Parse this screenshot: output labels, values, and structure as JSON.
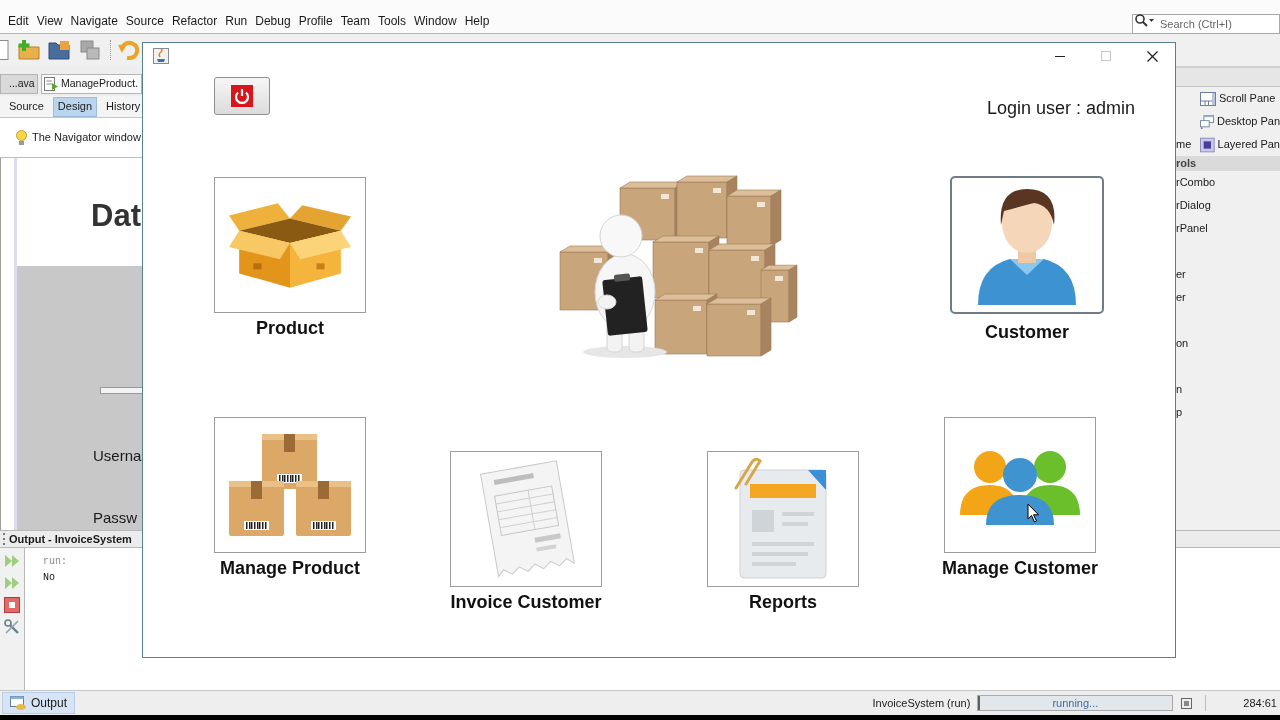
{
  "ide": {
    "menu": [
      "Edit",
      "View",
      "Navigate",
      "Source",
      "Refactor",
      "Run",
      "Debug",
      "Profile",
      "Team",
      "Tools",
      "Window",
      "Help"
    ],
    "search": {
      "placeholder": "Search (Ctrl+I)"
    },
    "editor_tabs": [
      {
        "label": "...ava",
        "selected": false
      },
      {
        "label": "ManageProduct.",
        "selected": true
      }
    ],
    "view_tabs": [
      {
        "label": "Source",
        "selected": false
      },
      {
        "label": "Design",
        "selected": true
      },
      {
        "label": "History",
        "selected": false
      }
    ],
    "navigator_hint": "The Navigator window",
    "design_form": {
      "heading": "Dat",
      "labels": [
        "Userna",
        "Passw"
      ]
    },
    "palette": {
      "rows": [
        {
          "right": "Scroll Pane",
          "kind": "scroll"
        },
        {
          "right": "Desktop Pan",
          "kind": "desktop"
        },
        {
          "left": "me",
          "right": "Layered Pan",
          "kind": "layered"
        }
      ],
      "section": "rols",
      "groups": [
        [
          "rCombo",
          "rDialog",
          "rPanel"
        ],
        [
          "er",
          "er"
        ],
        [
          "on"
        ],
        [
          "n",
          "p"
        ]
      ]
    },
    "output": {
      "title": "Output - InvoiceSystem",
      "lines": [
        {
          "text": "run:",
          "kind": "info"
        },
        {
          "text": "No",
          "kind": "stdout"
        }
      ]
    },
    "status_bar": {
      "tab": "Output",
      "task": "InvoiceSystem (run)",
      "progress": {
        "text": "running...",
        "level": 0.01
      },
      "position": "284:61"
    }
  },
  "dialog": {
    "login_label": "Login user : admin",
    "top_row": [
      {
        "label": "Product",
        "kind": "box",
        "focused": false
      },
      {
        "label": "Customer",
        "kind": "person",
        "focused": true
      }
    ],
    "bottom_row": [
      {
        "label": "Manage Product",
        "kind": "boxes",
        "focused": false
      },
      {
        "label": "Invoice Customer",
        "kind": "invoice",
        "focused": false
      },
      {
        "label": "Reports",
        "kind": "report",
        "focused": false
      },
      {
        "label": "Manage Customer",
        "kind": "people",
        "focused": false
      }
    ]
  }
}
